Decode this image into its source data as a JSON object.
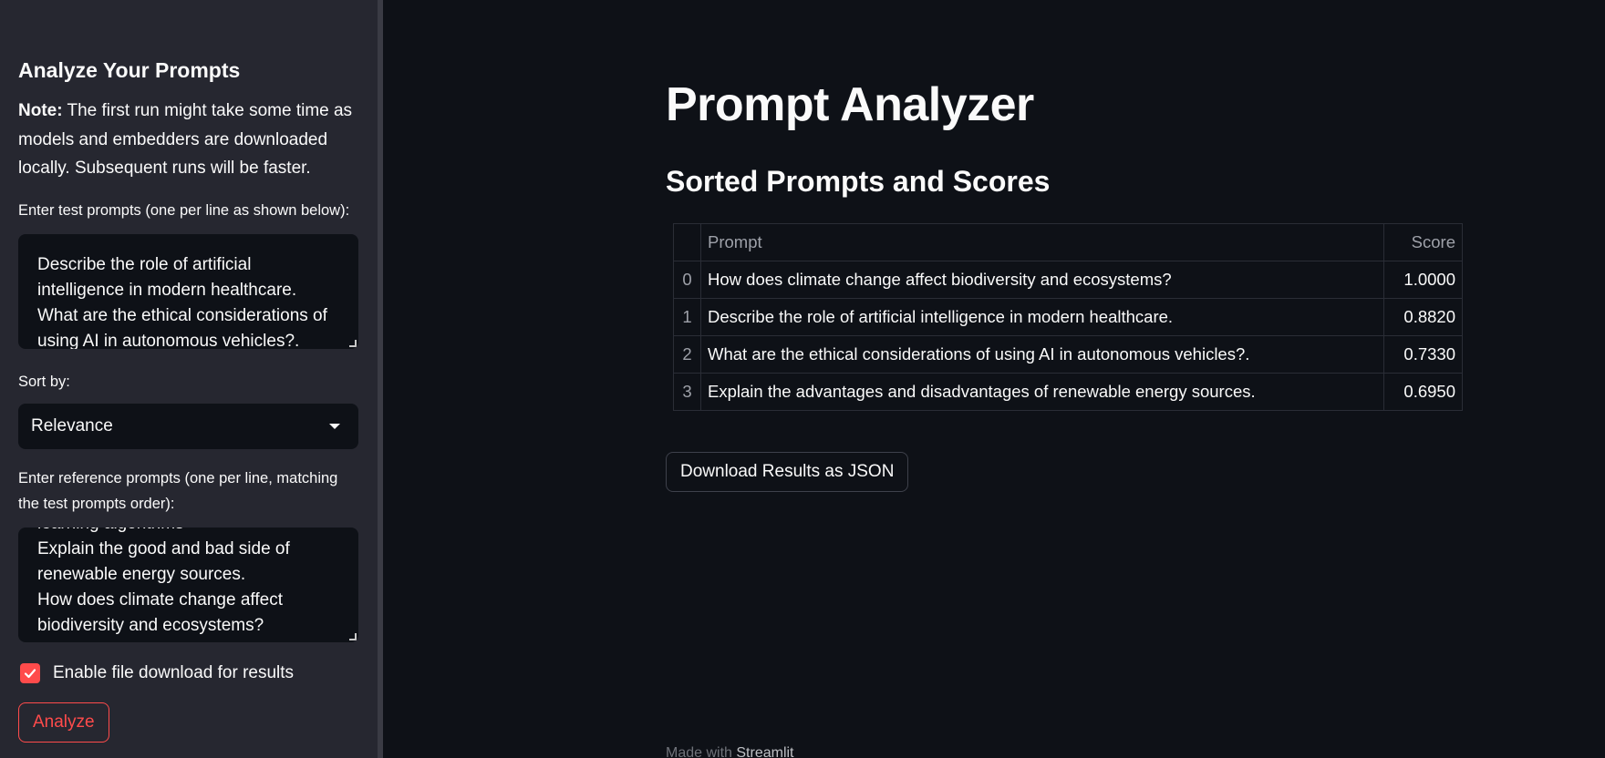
{
  "sidebar": {
    "title": "Analyze Your Prompts",
    "note_label": "Note:",
    "note_text": "The first run might take some time as models and embedders are downloaded locally. Subsequent runs will be faster.",
    "test_prompts_label": "Enter test prompts (one per line as shown below):",
    "test_prompts_lines": [
      "Describe the role of artificial",
      "intelligence in modern healthcare.",
      "What are the ethical considerations of",
      "using AI in autonomous vehicles?."
    ],
    "sort_label": "Sort by:",
    "sort_value": "Relevance",
    "reference_prompts_label": "Enter reference prompts (one per line, matching the test prompts order):",
    "reference_prompts_lines": [
      "learning algorithms",
      "Explain the good and bad side of",
      "renewable energy sources.",
      "How does climate change affect",
      "biodiversity and ecosystems?"
    ],
    "checkbox_label": "Enable file download for results",
    "checkbox_checked": true,
    "analyze_button": "Analyze"
  },
  "main": {
    "title": "Prompt Analyzer",
    "section_title": "Sorted Prompts and Scores",
    "table": {
      "headers": [
        "",
        "Prompt",
        "Score"
      ],
      "rows": [
        {
          "index": "0",
          "prompt": "How does climate change affect biodiversity and ecosystems?",
          "score": "1.0000"
        },
        {
          "index": "1",
          "prompt": "Describe the role of artificial intelligence in modern healthcare.",
          "score": "0.8820"
        },
        {
          "index": "2",
          "prompt": "What are the ethical considerations of using AI in autonomous vehicles?.",
          "score": "0.7330"
        },
        {
          "index": "3",
          "prompt": "Explain the advantages and disadvantages of renewable energy sources.",
          "score": "0.6950"
        }
      ]
    },
    "download_button": "Download Results as JSON"
  },
  "footer": {
    "prefix": "Made with",
    "brand": "Streamlit"
  },
  "colors": {
    "background": "#0e1117",
    "sidebar": "#262730",
    "accent": "#ff4b4b"
  }
}
